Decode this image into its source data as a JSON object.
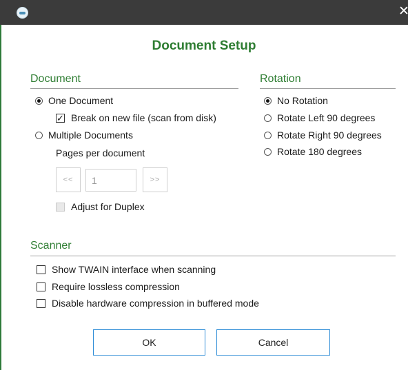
{
  "window": {
    "close_glyph": "✕"
  },
  "dialog": {
    "title": "Document Setup"
  },
  "document": {
    "heading": "Document",
    "one_document": "One Document",
    "break_on_new_file": "Break on new file (scan from disk)",
    "multiple_documents": "Multiple Documents",
    "pages_per_document": "Pages per document",
    "prev_label": "<<",
    "next_label": ">>",
    "pages_value": "1",
    "adjust_for_duplex": "Adjust for Duplex"
  },
  "rotation": {
    "heading": "Rotation",
    "options": [
      "No Rotation",
      "Rotate Left 90 degrees",
      "Rotate Right 90 degrees",
      "Rotate 180 degrees"
    ]
  },
  "scanner": {
    "heading": "Scanner",
    "options": [
      "Show TWAIN interface when scanning",
      "Require lossless compression",
      "Disable hardware compression in buffered mode"
    ]
  },
  "buttons": {
    "ok": "OK",
    "cancel": "Cancel"
  },
  "colors": {
    "accent_green": "#2e7d32",
    "titlebar": "#3b3b3b",
    "button_border": "#2d8cd6"
  },
  "icons": {
    "app": "app-logo-icon",
    "close": "close-icon"
  }
}
